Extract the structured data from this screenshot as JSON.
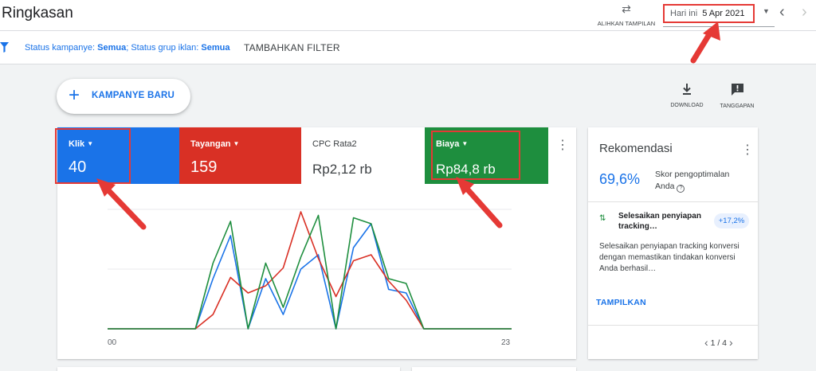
{
  "header": {
    "title": "Ringkasan",
    "switch_view_label": "ALIHKAN TAMPILAN",
    "date_prefix": "Hari ini",
    "date_value": "5 Apr 2021"
  },
  "filter": {
    "status_campaign_label": "Status kampanye:",
    "status_campaign_value": "Semua",
    "status_adgroup_label": "; Status grup iklan:",
    "status_adgroup_value": "Semua",
    "add_filter_label": "TAMBAHKAN FILTER"
  },
  "actions": {
    "new_campaign_label": "KAMPANYE BARU",
    "download_label": "DOWNLOAD",
    "feedback_label": "TANGGAPAN"
  },
  "metrics": [
    {
      "name": "Klik",
      "value": "40",
      "color": "#1a73e8"
    },
    {
      "name": "Tayangan",
      "value": "159",
      "color": "#d93025"
    },
    {
      "name": "CPC Rata2",
      "value": "Rp2,12 rb",
      "color": "#ffffff"
    },
    {
      "name": "Biaya",
      "value": "Rp84,8 rb",
      "color": "#1e8e3e"
    }
  ],
  "chart_data": {
    "type": "line",
    "x": [
      0,
      1,
      2,
      3,
      4,
      5,
      6,
      7,
      8,
      9,
      10,
      11,
      12,
      13,
      14,
      15,
      16,
      17,
      18,
      19,
      20,
      21,
      22,
      23
    ],
    "x_tick_labels": [
      "00",
      "23"
    ],
    "ylim": [
      0,
      1
    ],
    "grid": true,
    "series": [
      {
        "color": "#1a73e8",
        "values": [
          0,
          0,
          0,
          0,
          0,
          0,
          0.42,
          0.78,
          0,
          0.42,
          0.12,
          0.5,
          0.62,
          0,
          0.68,
          0.88,
          0.33,
          0.3,
          0,
          0,
          0,
          0,
          0,
          0
        ]
      },
      {
        "color": "#d93025",
        "values": [
          0,
          0,
          0,
          0,
          0,
          0,
          0.12,
          0.43,
          0.3,
          0.36,
          0.51,
          0.98,
          0.59,
          0.27,
          0.57,
          0.62,
          0.4,
          0.24,
          0,
          0,
          0,
          0,
          0,
          0
        ]
      },
      {
        "color": "#1e8e3e",
        "values": [
          0,
          0,
          0,
          0,
          0,
          0,
          0.55,
          0.9,
          0,
          0.55,
          0.18,
          0.6,
          0.95,
          0,
          0.93,
          0.88,
          0.42,
          0.38,
          0,
          0,
          0,
          0,
          0,
          0
        ]
      }
    ]
  },
  "recommendations": {
    "title": "Rekomendasi",
    "score": "69,6%",
    "score_label": "Skor pengoptimalan Anda",
    "item_title": "Selesaikan penyiapan tracking…",
    "item_uplift": "+17,2%",
    "item_desc": "Selesaikan penyiapan tracking konversi dengan memastikan tindakan konversi Anda berhasil…",
    "show_label": "TAMPILKAN",
    "pager": "1 / 4"
  },
  "colors": {
    "accent": "#1a73e8",
    "highlight": "#e53935"
  }
}
